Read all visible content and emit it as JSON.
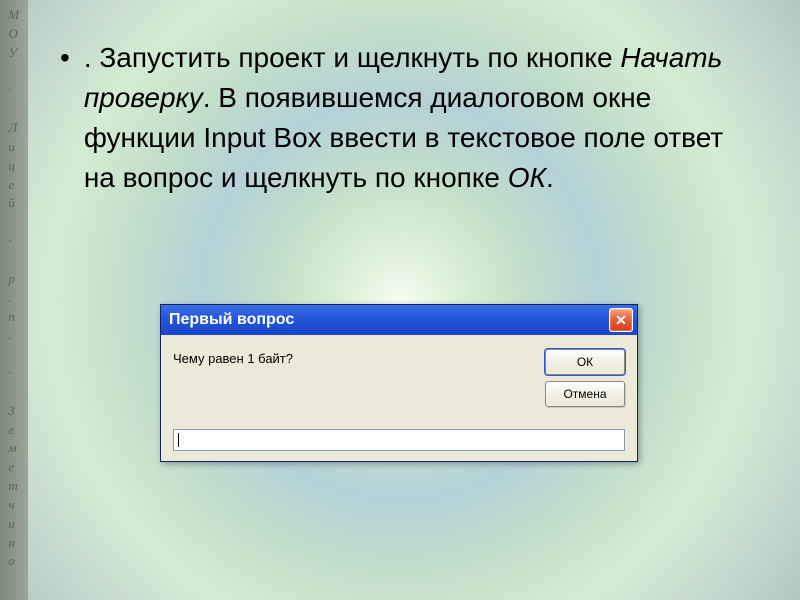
{
  "strip_text": "МОУ · Лицей · р.п. · Земетчино",
  "instruction": {
    "prefix": ". Запустить проект и щелкнуть по кнопке ",
    "italic1": "Начать проверку",
    "mid": ". В появившемся диалоговом окне функции Input Box ввести в текстовое поле ответ на вопрос и щелкнуть по кнопке ",
    "italic2": "ОК",
    "suffix": "."
  },
  "dialog": {
    "title": "Первый вопрос",
    "prompt": "Чему равен 1 байт?",
    "ok_label": "ОК",
    "cancel_label": "Отмена",
    "input_value": ""
  }
}
